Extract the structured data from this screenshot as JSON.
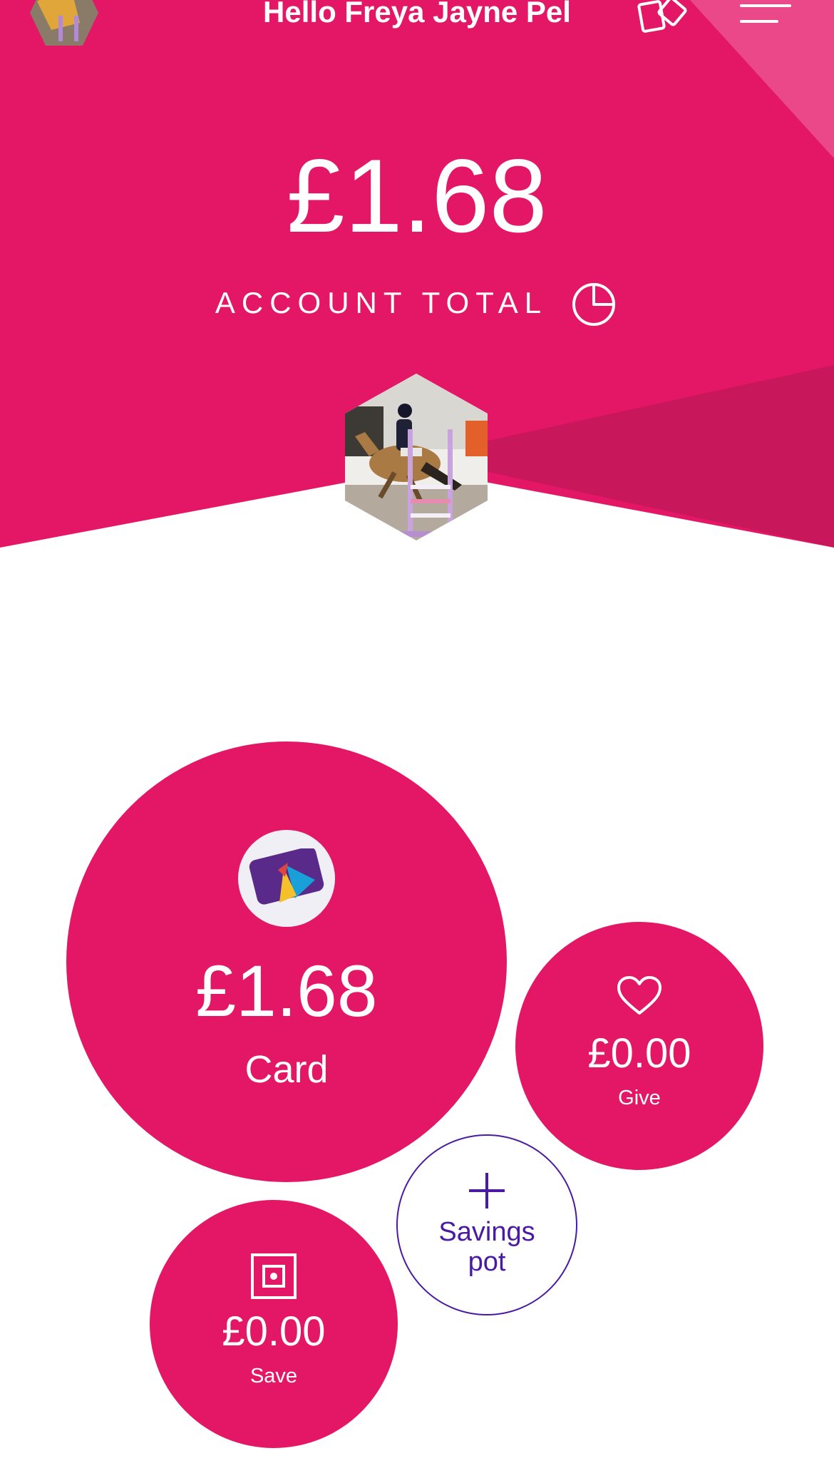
{
  "header": {
    "greeting": "Hello Freya Jayne Pel",
    "cards_icon": "cards-icon",
    "menu_icon": "menu-icon"
  },
  "account": {
    "total": "£1.68",
    "label": "ACCOUNT TOTAL",
    "chart_icon": "pie-chart-icon"
  },
  "pots": {
    "card": {
      "amount": "£1.68",
      "label": "Card",
      "icon": "prepaid-card-icon"
    },
    "give": {
      "amount": "£0.00",
      "label": "Give",
      "icon": "heart-icon"
    },
    "save": {
      "amount": "£0.00",
      "label": "Save",
      "icon": "safe-icon"
    },
    "new_savings_pot": {
      "label_line1": "Savings",
      "label_line2": "pot",
      "icon": "plus-icon"
    }
  },
  "colors": {
    "brand_pink": "#e31765",
    "accent_purple": "#4b1aa2",
    "white": "#ffffff"
  }
}
